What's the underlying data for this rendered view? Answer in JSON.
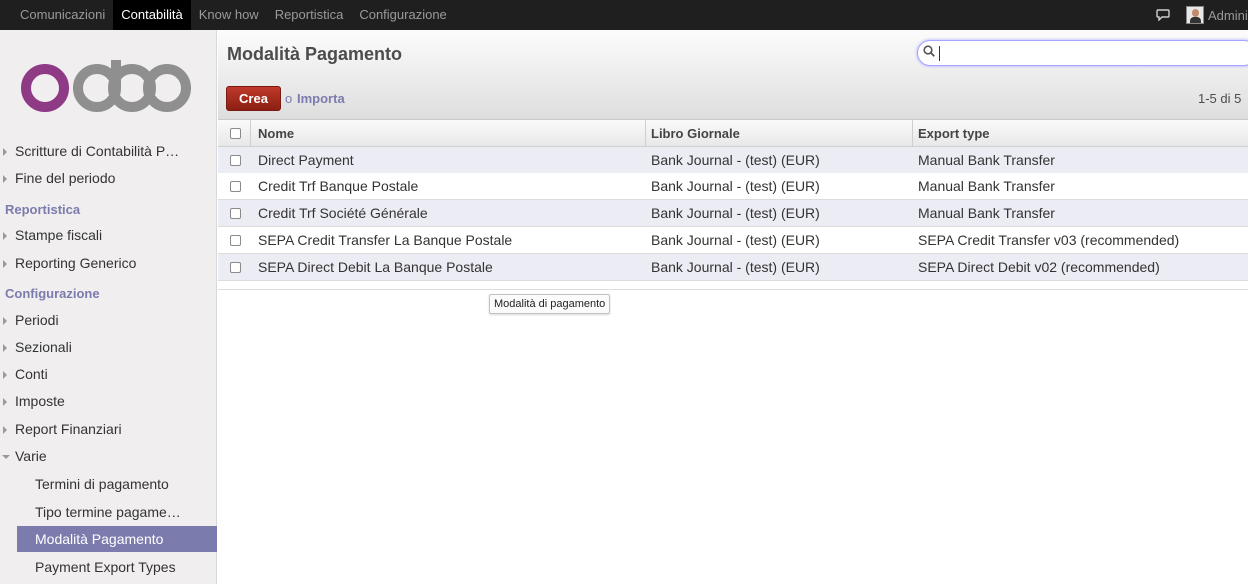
{
  "topbar": {
    "menu": [
      "Comunicazioni",
      "Contabilità",
      "Know how",
      "Reportistica",
      "Configurazione"
    ],
    "active_menu": "Contabilità",
    "user": "Administrator"
  },
  "sidebar": {
    "logo": "odoo",
    "items": [
      {
        "label": "Scritture di Contabilità P…"
      },
      {
        "label": "Fine del periodo"
      }
    ],
    "reportistica_header": "Reportistica",
    "reportistica_items": [
      {
        "label": "Stampe fiscali"
      },
      {
        "label": "Reporting Generico"
      }
    ],
    "configurazione_header": "Configurazione",
    "configurazione_items": [
      {
        "label": "Periodi"
      },
      {
        "label": "Sezionali"
      },
      {
        "label": "Conti"
      },
      {
        "label": "Imposte"
      },
      {
        "label": "Report Finanziari"
      },
      {
        "label": "Varie"
      }
    ],
    "varie_items": [
      {
        "label": "Termini di pagamento"
      },
      {
        "label": "Tipo termine pagame…"
      },
      {
        "label": "Modalità Pagamento"
      },
      {
        "label": "Payment Export Types"
      }
    ]
  },
  "header": {
    "title": "Modalità Pagamento",
    "search_value": "",
    "create_label": "Crea",
    "or_label": "o",
    "import_label": "Importa",
    "pager": "1-5 di 5"
  },
  "table": {
    "columns": [
      "Nome",
      "Libro Giornale",
      "Export type"
    ],
    "rows": [
      {
        "nome": "Direct Payment",
        "giornale": "Bank Journal - (test) (EUR)",
        "export": "Manual Bank Transfer"
      },
      {
        "nome": "Credit Trf Banque Postale",
        "giornale": "Bank Journal - (test) (EUR)",
        "export": "Manual Bank Transfer"
      },
      {
        "nome": "Credit Trf Société Générale",
        "giornale": "Bank Journal - (test) (EUR)",
        "export": "Manual Bank Transfer"
      },
      {
        "nome": "SEPA Credit Transfer La Banque Postale",
        "giornale": "Bank Journal - (test) (EUR)",
        "export": "SEPA Credit Transfer v03 (recommended)"
      },
      {
        "nome": "SEPA Direct Debit La Banque Postale",
        "giornale": "Bank Journal - (test) (EUR)",
        "export": "SEPA Direct Debit v02 (recommended)"
      }
    ]
  },
  "tooltip": "Modalità di pagamento",
  "colors": {
    "topbar_bg": "#1f1f1f",
    "accent": "#7c7bad",
    "create_button": "#a8281c",
    "sidebar_bg": "#f0eeee",
    "row_alt": "#ececf5"
  }
}
